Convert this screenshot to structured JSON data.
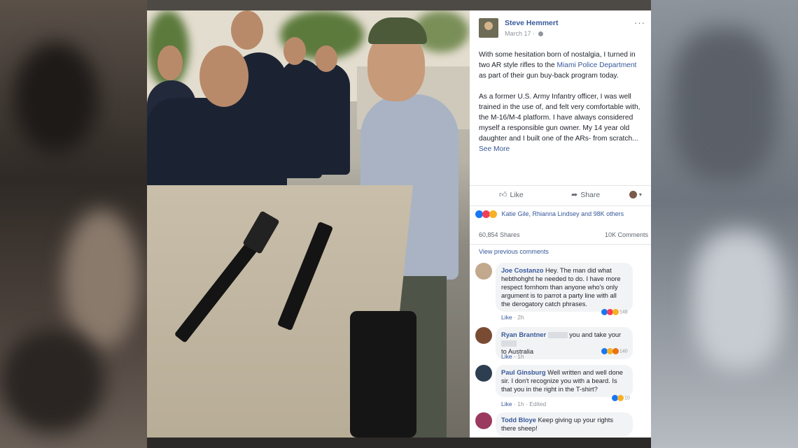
{
  "post": {
    "author": "Steve Hemmert",
    "date": "March 17",
    "more_icon": "···",
    "paragraph1_pre": "With some hesitation born of nostalgia, I turned in two AR style rifles to the ",
    "paragraph1_link": "Miami Police Department",
    "paragraph1_post": " as part of their gun buy-back program today.",
    "paragraph2": "As a former U.S. Army Infantry officer, I was well trained in the use of, and felt very comfortable with, the M-16/M-4 platform. I have always considered myself a responsible gun owner. My 14 year old daughter and I built one of the ARs- from scratch...",
    "see_more": "See More"
  },
  "actions": {
    "like_label": "Like",
    "share_label": "Share",
    "like_icon": "thumbs-up-icon",
    "share_icon": "share-arrow-icon"
  },
  "engagement": {
    "reactors": "Katie Gile, Rhianna Lindsey and 98K others",
    "shares": "60,854 Shares",
    "comments": "10K Comments",
    "view_previous": "View previous comments"
  },
  "comments": [
    {
      "name": "Joe Costanzo",
      "text": "Hey. The man did what hebthohght he needed to do. I have more respect fornhom than anyone who's only argument is to parrot a party line with all the derogatory catch phrases.",
      "like": "Like",
      "time": "2h",
      "reaction_count": "148"
    },
    {
      "name": "Ryan Brantner",
      "text_a": "you and take your",
      "text_b": "to Australia",
      "like": "Like",
      "time": "1h",
      "reaction_count": "140"
    },
    {
      "name": "Paul Ginsburg",
      "text": "Well written and well done sir. I don't recognize you with a beard. Is that you in the right in the T-shirt?",
      "like": "Like",
      "time": "1h",
      "edited": "Edited",
      "reaction_count": "10"
    },
    {
      "name": "Todd Bloye",
      "text": "Keep giving up your rights there sheep!"
    }
  ],
  "colors": {
    "link": "#365899",
    "meta": "#90949c",
    "bubble": "#f2f3f5"
  }
}
